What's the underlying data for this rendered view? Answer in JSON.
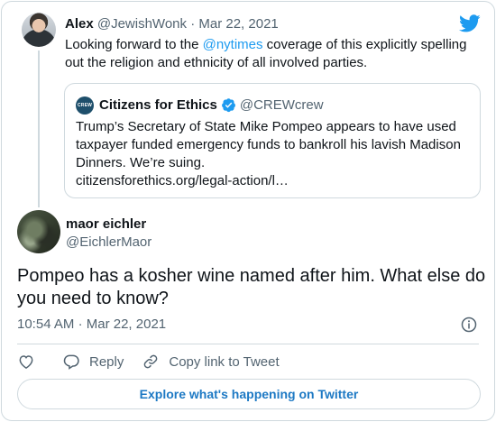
{
  "tweet1": {
    "name": "Alex",
    "handle": "@JewishWonk",
    "separator": "·",
    "date": "Mar 22, 2021",
    "text_before": "Looking forward to the ",
    "mention": "@nytimes",
    "text_after": " coverage of this explicitly spelling out the religion and ethnicity of all involved parties."
  },
  "quote": {
    "avatar_text": "CREW",
    "name": "Citizens for Ethics",
    "handle": "@CREWcrew",
    "text": "Trump’s Secretary of State Mike Pompeo appears to have used taxpayer funded emergency funds to bankroll his lavish Madison Dinners. We’re suing.",
    "link": "citizensforethics.org/legal-action/l…"
  },
  "tweet2": {
    "name": "maor eichler",
    "handle": "@EichlerMaor",
    "text": "Pompeo has a kosher wine named after him. What else do you need to know?",
    "time": "10:54 AM",
    "separator": "·",
    "date": "Mar 22, 2021"
  },
  "actions": {
    "reply": "Reply",
    "copy_link": "Copy link to Tweet"
  },
  "explore": "Explore what's happening on Twitter",
  "icons": {
    "brand": "twitter-bird-icon",
    "verified": "verified-badge-icon",
    "info": "info-icon",
    "like": "heart-icon",
    "reply": "reply-bubble-icon",
    "link": "link-icon"
  },
  "colors": {
    "accent": "#1d9bf0",
    "text": "#0f1419",
    "muted": "#536471",
    "border": "#cfd9de"
  }
}
